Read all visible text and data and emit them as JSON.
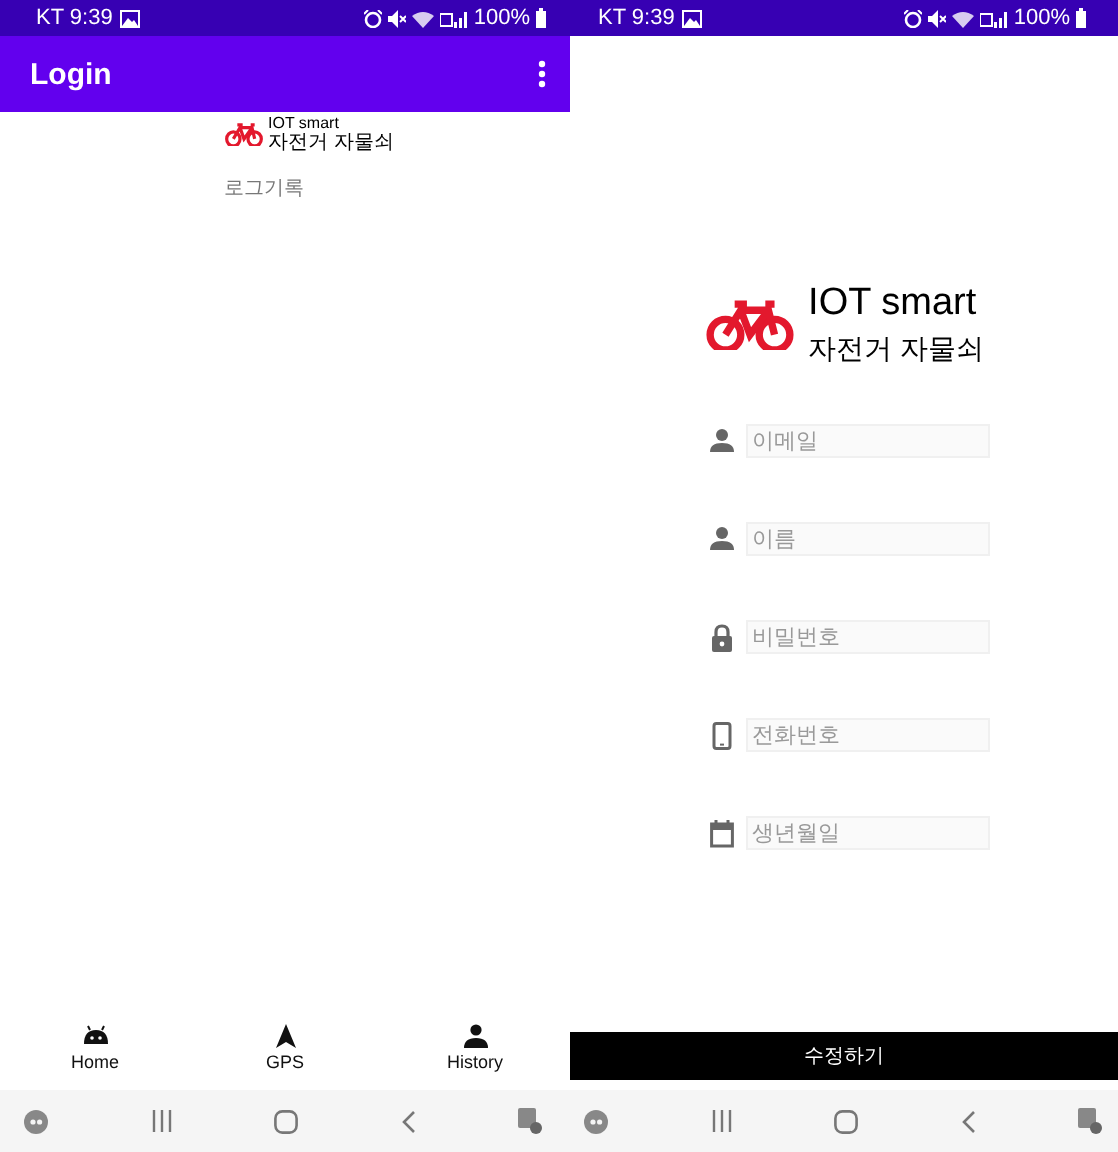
{
  "left_screen": {
    "status_bar": {
      "time": "KT 9:39",
      "battery": "100%"
    },
    "app_bar": {
      "title": "Login"
    },
    "logo": {
      "line1": "IOT smart",
      "line2": "자전거 자물쇠"
    },
    "link": "로그기록",
    "bottom_nav": [
      {
        "kind": "home",
        "label": "Home",
        "selected": false
      },
      {
        "kind": "gps",
        "label": "GPS",
        "selected": false
      },
      {
        "kind": "history",
        "label": "History",
        "selected": false
      }
    ]
  },
  "right_screen": {
    "status_bar": {
      "time": "KT 9:39",
      "battery": "100%"
    },
    "logo": {
      "line1": "IOT smart",
      "line2": "자전거 자물쇠"
    },
    "fields": [
      {
        "kind": "email",
        "placeholder": "이메일"
      },
      {
        "kind": "name",
        "placeholder": "이름"
      },
      {
        "kind": "password",
        "placeholder": "비밀번호"
      },
      {
        "kind": "phone",
        "placeholder": "전화번호"
      },
      {
        "kind": "date",
        "placeholder": "생년월일"
      }
    ],
    "button": "수정하기"
  }
}
